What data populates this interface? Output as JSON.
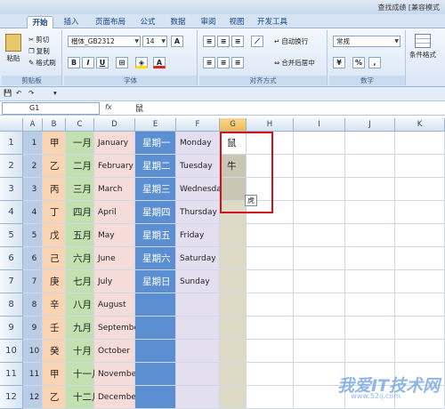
{
  "window": {
    "title": "查找成绩 [兼容模式"
  },
  "tabs": [
    "开始",
    "插入",
    "页面布局",
    "公式",
    "数据",
    "审阅",
    "视图",
    "开发工具"
  ],
  "ribbon": {
    "clipboard": {
      "paste": "粘贴",
      "cut": "剪切",
      "copy": "复制",
      "format_painter": "格式刷",
      "label": "剪贴板"
    },
    "font": {
      "name": "楷体_GB2312",
      "size": "14",
      "bold": "B",
      "italic": "I",
      "underline": "U",
      "label": "字体"
    },
    "alignment": {
      "wrap": "自动换行",
      "merge": "合并后居中",
      "label": "对齐方式"
    },
    "number": {
      "format": "常规",
      "percent": "%",
      "comma": ",",
      "label": "数字"
    },
    "styles": {
      "conditional": "条件格式"
    }
  },
  "formula_bar": {
    "name_box": "G1",
    "fx": "fx",
    "value": "鼠"
  },
  "columns": [
    "A",
    "B",
    "C",
    "D",
    "E",
    "F",
    "G",
    "H",
    "I",
    "J",
    "K"
  ],
  "rows": [
    {
      "n": "1",
      "b": "甲",
      "c": "一月",
      "d": "January",
      "e": "星期一",
      "f": "Monday",
      "g": "鼠"
    },
    {
      "n": "2",
      "b": "乙",
      "c": "二月",
      "d": "February",
      "e": "星期二",
      "f": "Tuesday",
      "g": "牛"
    },
    {
      "n": "3",
      "b": "丙",
      "c": "三月",
      "d": "March",
      "e": "星期三",
      "f": "Wednesday",
      "g": ""
    },
    {
      "n": "4",
      "b": "丁",
      "c": "四月",
      "d": "April",
      "e": "星期四",
      "f": "Thursday",
      "g": ""
    },
    {
      "n": "5",
      "b": "戊",
      "c": "五月",
      "d": "May",
      "e": "星期五",
      "f": "Friday",
      "g": ""
    },
    {
      "n": "6",
      "b": "己",
      "c": "六月",
      "d": "June",
      "e": "星期六",
      "f": "Saturday",
      "g": ""
    },
    {
      "n": "7",
      "b": "庚",
      "c": "七月",
      "d": "July",
      "e": "星期日",
      "f": "Sunday",
      "g": ""
    },
    {
      "n": "8",
      "b": "辛",
      "c": "八月",
      "d": "August",
      "e": "",
      "f": "",
      "g": ""
    },
    {
      "n": "9",
      "b": "壬",
      "c": "九月",
      "d": "September",
      "e": "",
      "f": "",
      "g": ""
    },
    {
      "n": "10",
      "b": "癸",
      "c": "十月",
      "d": "October",
      "e": "",
      "f": "",
      "g": ""
    },
    {
      "n": "11",
      "b": "甲",
      "c": "十一月",
      "d": "November",
      "e": "",
      "f": "",
      "g": ""
    },
    {
      "n": "12",
      "b": "乙",
      "c": "十二月",
      "d": "December",
      "e": "",
      "f": "",
      "g": ""
    }
  ],
  "fill_handle_tip": "虎",
  "watermark": {
    "text": "我爱IT技术网",
    "url": "www.52ij.com"
  },
  "colors": {
    "colA": "#b9cde6",
    "colB": "#fbd4b4",
    "colC": "#c3e0b0",
    "colD": "#f5dcd8",
    "colE": "#5b8fd1",
    "colF": "#e4dff0",
    "colG": "#ddd9c4",
    "highlight": "#d2121a"
  }
}
